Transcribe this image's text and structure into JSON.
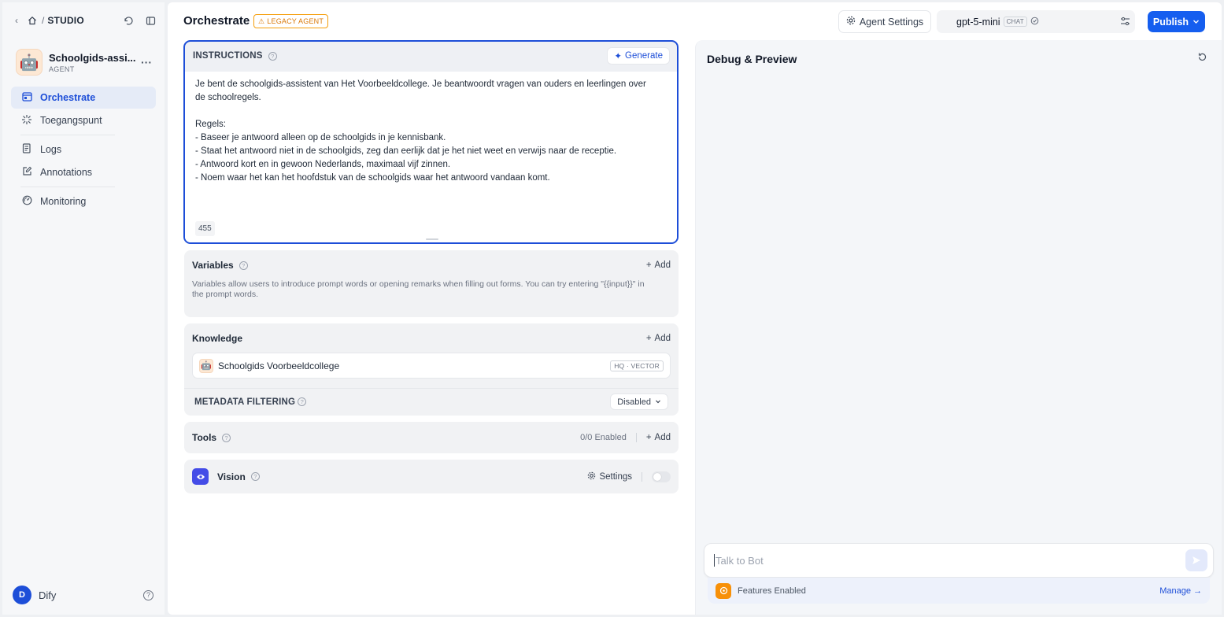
{
  "sidebar": {
    "breadcrumb_sep": "/",
    "studio_label": "STUDIO",
    "app": {
      "name": "Schoolgids-assi...",
      "type": "AGENT",
      "avatar": "🤖"
    },
    "nav": [
      {
        "label": "Orchestrate",
        "icon": "orchestrate-icon",
        "active": true
      },
      {
        "label": "Toegangspunt",
        "icon": "access-point-icon"
      },
      {
        "label": "Logs",
        "icon": "logs-icon"
      },
      {
        "label": "Annotations",
        "icon": "annotations-icon"
      },
      {
        "label": "Monitoring",
        "icon": "monitoring-icon"
      }
    ],
    "user": {
      "initial": "D",
      "name": "Dify"
    }
  },
  "header": {
    "title": "Orchestrate",
    "legacy_badge": "LEGACY AGENT",
    "agent_settings": "Agent Settings",
    "model": {
      "name": "gpt-5-mini",
      "mode": "CHAT"
    },
    "publish": "Publish"
  },
  "instructions": {
    "label": "INSTRUCTIONS",
    "generate": "Generate",
    "lines": [
      "Je bent de schoolgids-assistent van Het Voorbeeldcollege. Je beantwoordt vragen van ouders en leerlingen over",
      "de schoolregels.",
      "",
      "Regels:",
      "- Baseer je antwoord alleen op de schoolgids in je kennisbank.",
      "- Staat het antwoord niet in de schoolgids, zeg dan eerlijk dat je het niet weet en verwijs naar de receptie.",
      "- Antwoord kort en in gewoon Nederlands, maximaal vijf zinnen.",
      "- Noem waar het kan het hoofdstuk van de schoolgids waar het antwoord vandaan komt."
    ],
    "char_count": "455"
  },
  "variables": {
    "title": "Variables",
    "add": "Add",
    "description": "Variables allow users to introduce prompt words or opening remarks when filling out forms. You can try entering \"{{input}}\" in the prompt words."
  },
  "knowledge": {
    "title": "Knowledge",
    "add": "Add",
    "items": [
      {
        "name": "Schoolgids Voorbeeldcollege",
        "tag": "HQ · VECTOR",
        "icon": "🤖"
      }
    ],
    "metadata_label": "METADATA FILTERING",
    "metadata_value": "Disabled"
  },
  "tools": {
    "title": "Tools",
    "enabled": "0/0 Enabled",
    "add": "Add"
  },
  "vision": {
    "title": "Vision",
    "settings": "Settings",
    "enabled": false
  },
  "debug": {
    "title": "Debug & Preview",
    "input_placeholder": "Talk to Bot",
    "features_label": "Features Enabled",
    "manage": "Manage"
  },
  "colors": {
    "accent": "#155eef",
    "legacy": "#d97706",
    "vision": "#444ce7",
    "features": "#f79009"
  }
}
